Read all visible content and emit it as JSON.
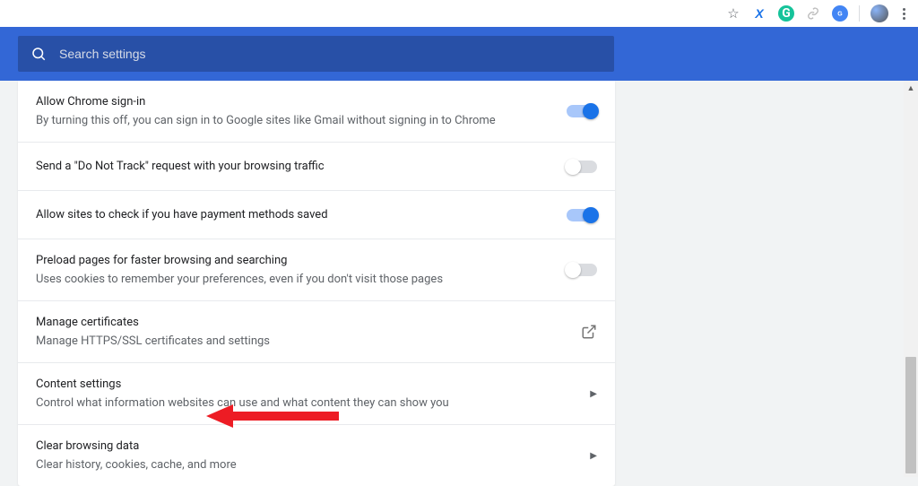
{
  "toolbar": {
    "star_glyph": "☆"
  },
  "search": {
    "placeholder": "Search settings"
  },
  "settings": [
    {
      "title": "Allow Chrome sign-in",
      "subtitle": "By turning this off, you can sign in to Google sites like Gmail without signing in to Chrome",
      "control": "toggle",
      "state": "on"
    },
    {
      "title": "Send a \"Do Not Track\" request with your browsing traffic",
      "subtitle": "",
      "control": "toggle",
      "state": "off"
    },
    {
      "title": "Allow sites to check if you have payment methods saved",
      "subtitle": "",
      "control": "toggle",
      "state": "on"
    },
    {
      "title": "Preload pages for faster browsing and searching",
      "subtitle": "Uses cookies to remember your preferences, even if you don't visit those pages",
      "control": "toggle",
      "state": "off"
    },
    {
      "title": "Manage certificates",
      "subtitle": "Manage HTTPS/SSL certificates and settings",
      "control": "external",
      "state": ""
    },
    {
      "title": "Content settings",
      "subtitle": "Control what information websites can use and what content they can show you",
      "control": "chevron",
      "state": ""
    },
    {
      "title": "Clear browsing data",
      "subtitle": "Clear history, cookies, cache, and more",
      "control": "chevron",
      "state": ""
    }
  ]
}
